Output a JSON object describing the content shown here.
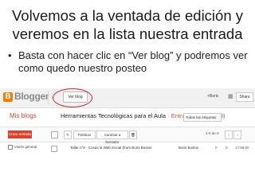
{
  "slide": {
    "title": "Volvemos a la ventada de edición y veremos en la lista nuestra entrada",
    "bullet_marker": "•",
    "bullet": "Basta con hacer clic en “Ver blog” y podremos ver como quedo nuestro posteo"
  },
  "blogger": {
    "logo_letter": "B",
    "logo_text": "Blogger",
    "view_blog_button": "Ver blog",
    "user": "+Boris",
    "share_button": "Share",
    "my_blogs": "Mis blogs",
    "blog_name": "Herramientas Tecnológicas para el Aula",
    "breadcrumb_rest": " · Entradas › Todas (9)",
    "all_labels_select": "Todas las etiquetas",
    "new_post_button": "Crear entrada",
    "publish_button": "Publicar",
    "revert_button": "Cambiar a borrador",
    "pager_text": "1-9 de 9",
    "post_title": "Taller n°5 - Cosas la Web Social (from Boris Bustos",
    "post_author": "Boris Bustos",
    "post_comments": "0",
    "post_views": "0",
    "post_date": "17:58:00",
    "overview": "Visión general",
    "accent_color": "#d14836",
    "circle_color": "#d8222a"
  }
}
